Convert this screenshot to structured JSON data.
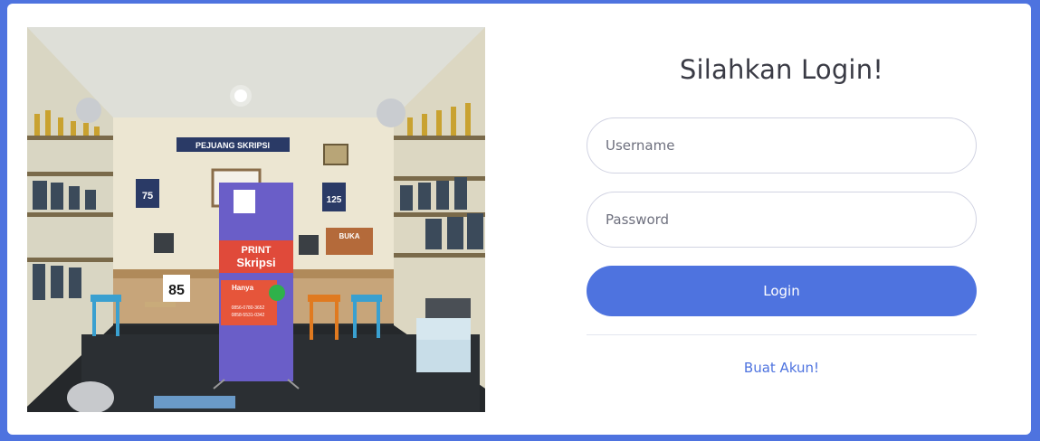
{
  "login": {
    "title": "Silahkan Login!",
    "username_placeholder": "Username",
    "password_placeholder": "Password",
    "login_button": "Login",
    "register_link": "Buat Akun!"
  },
  "photo": {
    "banner_top": "PEJUANG SKRIPSI",
    "standee_line1": "PRINT",
    "standee_line2": "Skripsi",
    "standee_price": "Hanya",
    "standee_phone1": "0856-0780-3652",
    "standee_phone2": "0858-5531-0342",
    "chair_number": "85",
    "board_buka": "BUKA",
    "badge_75": "75",
    "badge_125": "125"
  },
  "colors": {
    "background": "#4e73df",
    "card": "#ffffff",
    "button": "#4e73df",
    "link": "#4e73df",
    "title": "#3a3b45"
  }
}
